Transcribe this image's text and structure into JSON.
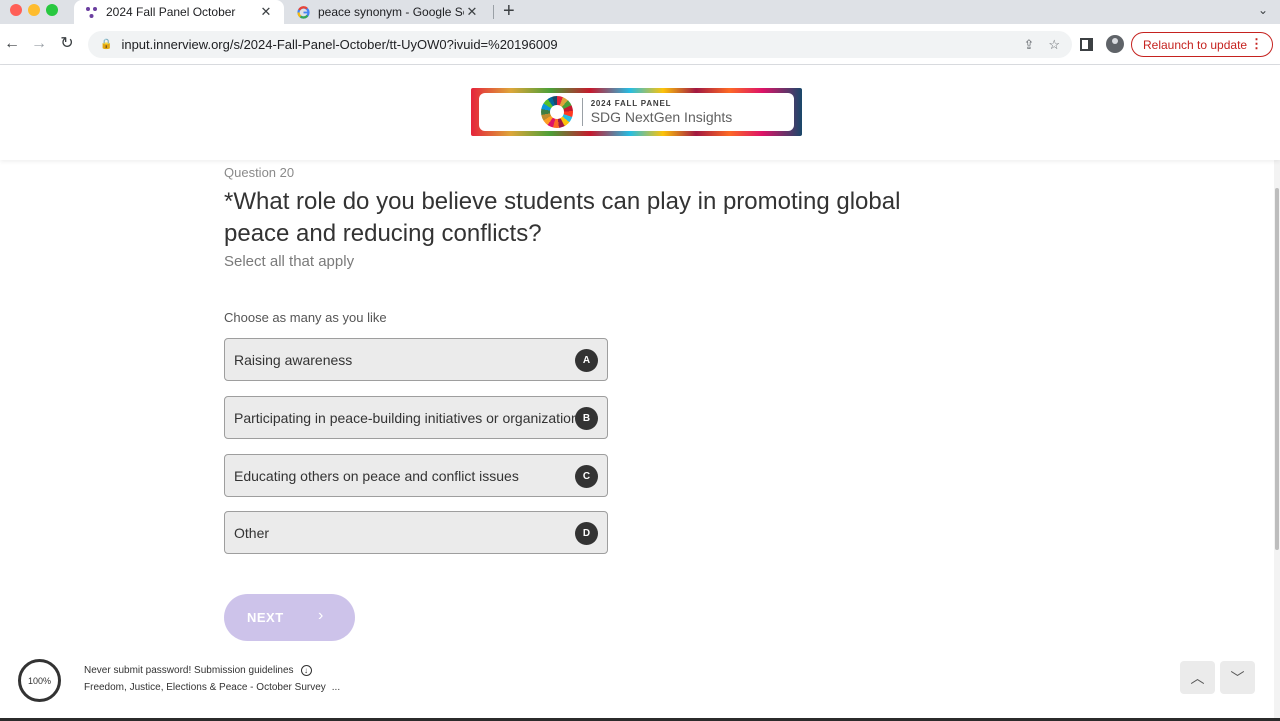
{
  "browser": {
    "tabs": [
      {
        "title": "2024 Fall Panel October",
        "close": "✕"
      },
      {
        "title": "peace synonym - Google Search",
        "close": "✕"
      }
    ],
    "new_tab": "+",
    "tab_menu": "⌄",
    "url": "input.innerview.org/s/2024-Fall-Panel-October/tt-UyOW0?ivuid=%20196009",
    "relaunch_label": "Relaunch to update",
    "relaunch_menu": "⋮",
    "icons": {
      "back": "←",
      "forward": "→",
      "reload": "↻",
      "lock": "🔒",
      "share": "⇪",
      "bookmark": "☆"
    }
  },
  "banner": {
    "top": "2024 FALL PANEL",
    "bottom": "SDG NextGen Insights"
  },
  "question": {
    "number": "Question 20",
    "title": "*What role do you believe students can play in promoting global peace and reducing conflicts?",
    "instruction": "Select all that apply",
    "hint": "Choose as many as you like",
    "options": [
      {
        "label": "Raising awareness",
        "key": "A"
      },
      {
        "label": "Participating in peace-building initiatives or organizations",
        "key": "B"
      },
      {
        "label": "Educating others on peace and conflict issues",
        "key": "C"
      },
      {
        "label": "Other",
        "key": "D"
      }
    ],
    "next_label": "NEXT",
    "next_arrow": "›"
  },
  "footer": {
    "progress": "100%",
    "notice": "Never submit password! Submission guidelines",
    "download_glyph": "↓",
    "survey_name": "Freedom, Justice, Elections & Peace - October Survey",
    "more": "...",
    "up_arrow": "︿",
    "down_arrow": "﹀"
  },
  "colors": {
    "accent": "#cdc3ea",
    "option_bg": "#ebebeb",
    "key_badge": "#333333",
    "relaunch": "#c5221f"
  }
}
